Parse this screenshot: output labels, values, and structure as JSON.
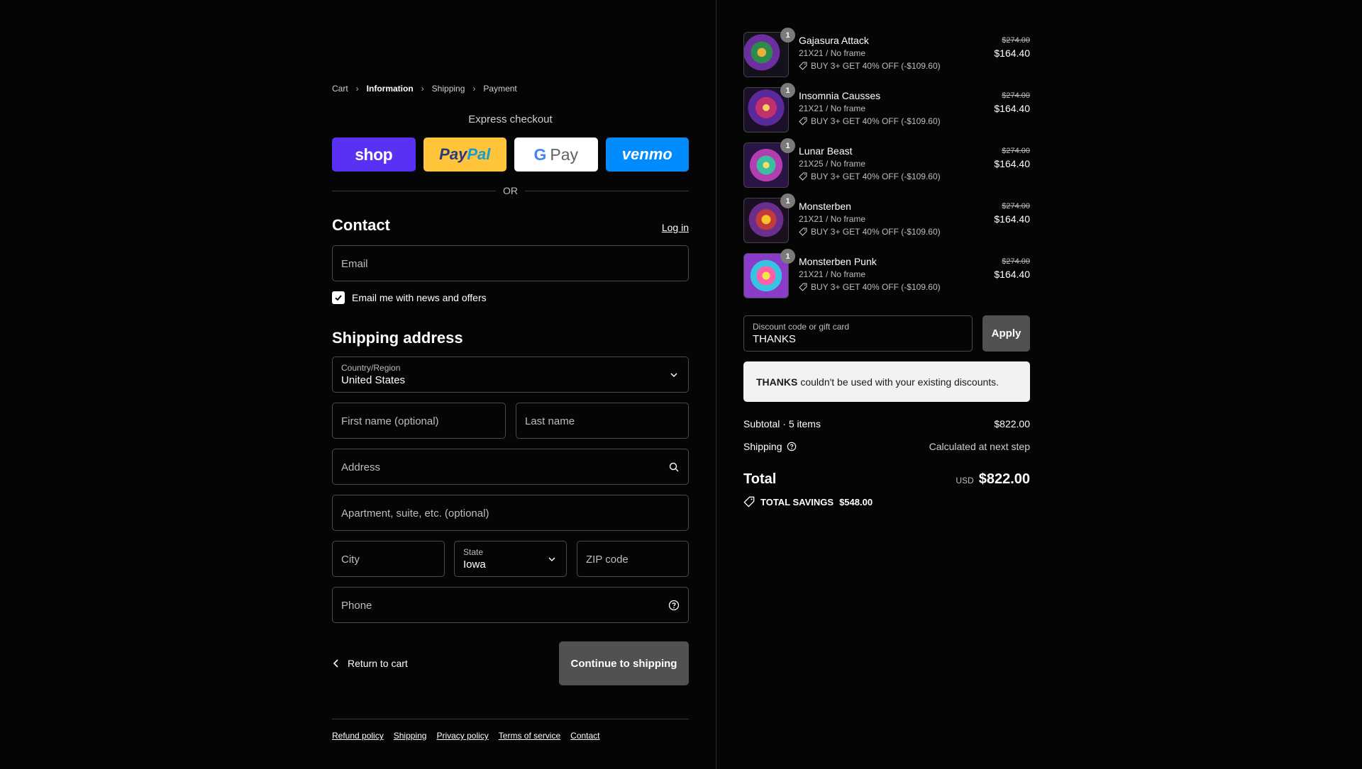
{
  "breadcrumb": [
    "Cart",
    "Information",
    "Shipping",
    "Payment"
  ],
  "express": {
    "title": "Express checkout",
    "shop": "shop",
    "paypal_a": "Pay",
    "paypal_b": "Pal",
    "gpay_g": "G",
    "gpay": "Pay",
    "venmo": "venmo",
    "or": "OR"
  },
  "contact": {
    "title": "Contact",
    "login": "Log in",
    "email_placeholder": "Email",
    "news_label": "Email me with news and offers"
  },
  "shipping": {
    "title": "Shipping address",
    "country_label": "Country/Region",
    "country_value": "United States",
    "first_name": "First name (optional)",
    "last_name": "Last name",
    "address": "Address",
    "apartment": "Apartment, suite, etc. (optional)",
    "city": "City",
    "state_label": "State",
    "state_value": "Iowa",
    "zip": "ZIP code",
    "phone": "Phone"
  },
  "nav": {
    "return": "Return to cart",
    "continue": "Continue to shipping"
  },
  "footer": [
    "Refund policy",
    "Shipping",
    "Privacy policy",
    "Terms of service",
    "Contact"
  ],
  "items": [
    {
      "name": "Gajasura Attack",
      "variant": "21X21 / No frame",
      "discount": "BUY 3+ GET 40% OFF (-$109.60)",
      "old": "$274.00",
      "price": "$164.40",
      "qty": "1"
    },
    {
      "name": "Insomnia Causses",
      "variant": "21X21 / No frame",
      "discount": "BUY 3+ GET 40% OFF (-$109.60)",
      "old": "$274.00",
      "price": "$164.40",
      "qty": "1"
    },
    {
      "name": "Lunar Beast",
      "variant": "21X25 / No frame",
      "discount": "BUY 3+ GET 40% OFF (-$109.60)",
      "old": "$274.00",
      "price": "$164.40",
      "qty": "1"
    },
    {
      "name": "Monsterben",
      "variant": "21X21 / No frame",
      "discount": "BUY 3+ GET 40% OFF (-$109.60)",
      "old": "$274.00",
      "price": "$164.40",
      "qty": "1"
    },
    {
      "name": "Monsterben Punk",
      "variant": "21X21 / No frame",
      "discount": "BUY 3+ GET 40% OFF (-$109.60)",
      "old": "$274.00",
      "price": "$164.40",
      "qty": "1"
    }
  ],
  "discount": {
    "label": "Discount code or gift card",
    "value": "THANKS",
    "apply": "Apply",
    "alert_code": "THANKS",
    "alert_text": "couldn't be used with your existing discounts."
  },
  "summary": {
    "subtotal_label": "Subtotal · 5 items",
    "subtotal": "$822.00",
    "shipping_label": "Shipping",
    "shipping_value": "Calculated at next step",
    "total_label": "Total",
    "currency": "USD",
    "total": "$822.00",
    "savings_label": "TOTAL SAVINGS",
    "savings": "$548.00"
  },
  "colors": {
    "background": "#050505",
    "shop_pay": "#5a31f4",
    "paypal": "#ffc439",
    "venmo": "#008cff",
    "button_gray": "#515151"
  }
}
